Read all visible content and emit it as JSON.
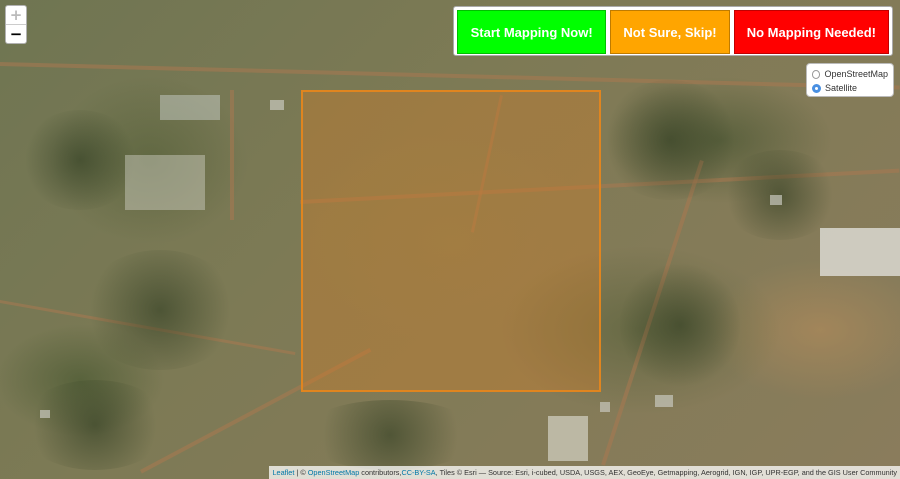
{
  "map": {
    "zoom_in_label": "+",
    "zoom_out_label": "−",
    "zoom_in_disabled": true,
    "aoi_color": "#e0851f"
  },
  "actions": [
    {
      "label": "Start Mapping Now!",
      "color": "#00ff00"
    },
    {
      "label": "Not Sure, Skip!",
      "color": "#ffa500"
    },
    {
      "label": "No Mapping Needed!",
      "color": "#ff0000"
    }
  ],
  "layers": {
    "options": [
      {
        "label": "OpenStreetMap",
        "selected": false
      },
      {
        "label": "Satellite",
        "selected": true
      }
    ]
  },
  "attribution": {
    "leaflet": "Leaflet",
    "sep1": " | © ",
    "osm": "OpenStreetMap",
    "contributors": " contributors,",
    "license": "CC-BY-SA",
    "tiles": ", Tiles © Esri — Source: Esri, i-cubed, USDA, USGS, AEX, GeoEye, Getmapping, Aerogrid, IGN, IGP, UPR-EGP, and the GIS User Community"
  }
}
